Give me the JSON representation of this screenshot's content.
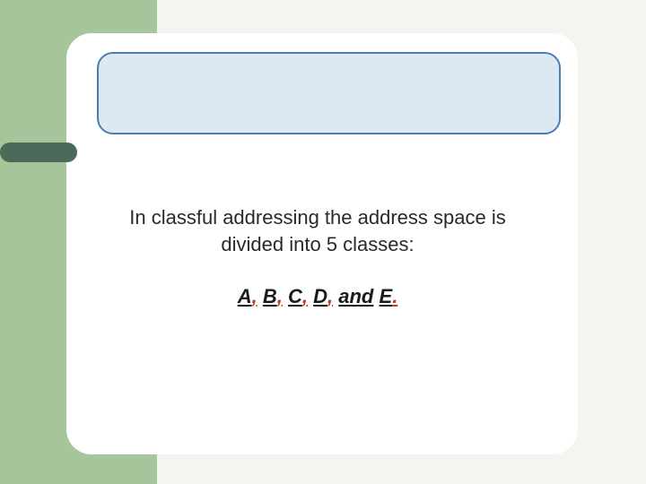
{
  "slide": {
    "body_line1": "In classful addressing the address space is",
    "body_line2": "divided into  5 classes:",
    "classes": {
      "A": "A",
      "B": "B",
      "C": "C",
      "D": "D",
      "and": "and",
      "E": "E",
      "comma": ",",
      "period": "."
    }
  }
}
